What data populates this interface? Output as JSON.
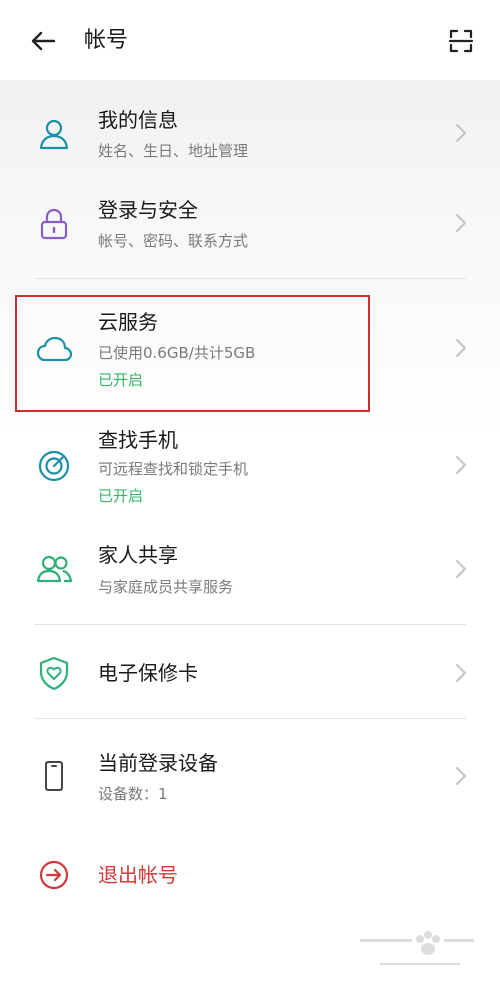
{
  "header": {
    "title": "帐号"
  },
  "items": [
    {
      "label": "我的信息",
      "sub": "姓名、生日、地址管理"
    },
    {
      "label": "登录与安全",
      "sub": "帐号、密码、联系方式"
    },
    {
      "label": "云服务",
      "sub": "已使用0.6GB/共计5GB",
      "status": "已开启"
    },
    {
      "label": "查找手机",
      "sub": "可远程查找和锁定手机",
      "status": "已开启"
    },
    {
      "label": "家人共享",
      "sub": "与家庭成员共享服务"
    },
    {
      "label": "电子保修卡"
    },
    {
      "label": "当前登录设备",
      "sub": "设备数：1"
    }
  ],
  "logout": {
    "label": "退出帐号"
  },
  "colors": {
    "accent_green": "#35b566",
    "icon_teal": "#1f8fa8",
    "icon_purple": "#8a5cc7",
    "danger_red": "#d23a3a"
  }
}
